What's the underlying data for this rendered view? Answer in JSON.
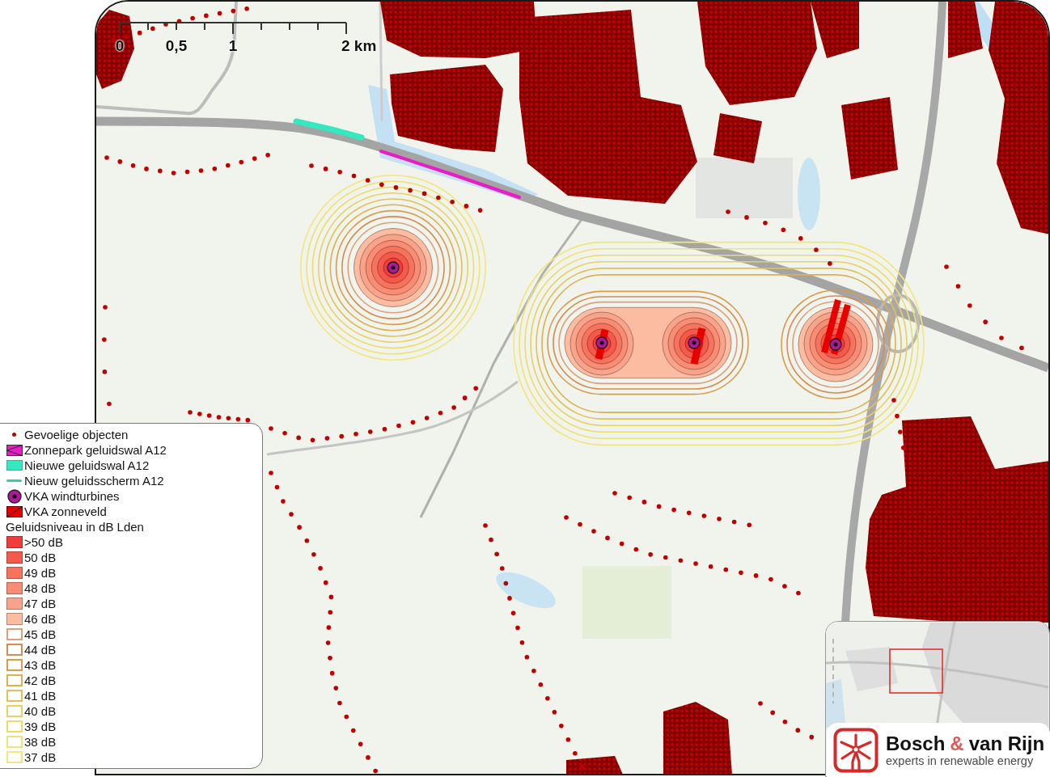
{
  "scale_bar": {
    "labels": [
      "0",
      "0,5",
      "1",
      "2 km"
    ]
  },
  "legend": {
    "items": [
      {
        "kind": "dot",
        "label": "Gevoelige objecten",
        "color": "#c00000"
      },
      {
        "kind": "hatched-strip",
        "label": "Zonnepark geluidswal A12",
        "color": "#e81cc8"
      },
      {
        "kind": "strip",
        "label": "Nieuwe geluidswal A12",
        "color": "#34e8c0"
      },
      {
        "kind": "line",
        "label": "Nieuw geluidsscherm A12",
        "color": "#3cc8a8"
      },
      {
        "kind": "turbine",
        "label": "VKA windturbines",
        "color": "#b0189a"
      },
      {
        "kind": "hatched-area",
        "label": "VKA zonneveld",
        "color": "#e80000"
      }
    ],
    "heading": "Geluidsniveau in dB Lden",
    "noise_levels": [
      {
        "label": ">50 dB",
        "color": "#f23c3c",
        "filled": true
      },
      {
        "label": "50 dB",
        "color": "#f45a4a",
        "filled": true
      },
      {
        "label": "49 dB",
        "color": "#f6745e",
        "filled": true
      },
      {
        "label": "48 dB",
        "color": "#f88c74",
        "filled": true
      },
      {
        "label": "47 dB",
        "color": "#f9a48a",
        "filled": true
      },
      {
        "label": "46 dB",
        "color": "#fbbca2",
        "filled": true
      },
      {
        "label": "45 dB",
        "color": "#dba07e",
        "filled": false
      },
      {
        "label": "44 dB",
        "color": "#d48c50",
        "filled": false
      },
      {
        "label": "43 dB",
        "color": "#d89c4c",
        "filled": false
      },
      {
        "label": "42 dB",
        "color": "#ddb050",
        "filled": false
      },
      {
        "label": "41 dB",
        "color": "#e2c058",
        "filled": false
      },
      {
        "label": "40 dB",
        "color": "#e8d064",
        "filled": false
      },
      {
        "label": "39 dB",
        "color": "#ecdc6e",
        "filled": false
      },
      {
        "label": "38 dB",
        "color": "#f0e276",
        "filled": false
      },
      {
        "label": "37 dB",
        "color": "#f2e67c",
        "filled": false
      }
    ]
  },
  "logo": {
    "name_parts": [
      {
        "kind": "word",
        "text": "Bosch"
      },
      {
        "kind": "ampersand",
        "text": "&"
      },
      {
        "kind": "word",
        "text": "van Rijn"
      }
    ],
    "tagline": "experts in renewable energy"
  }
}
